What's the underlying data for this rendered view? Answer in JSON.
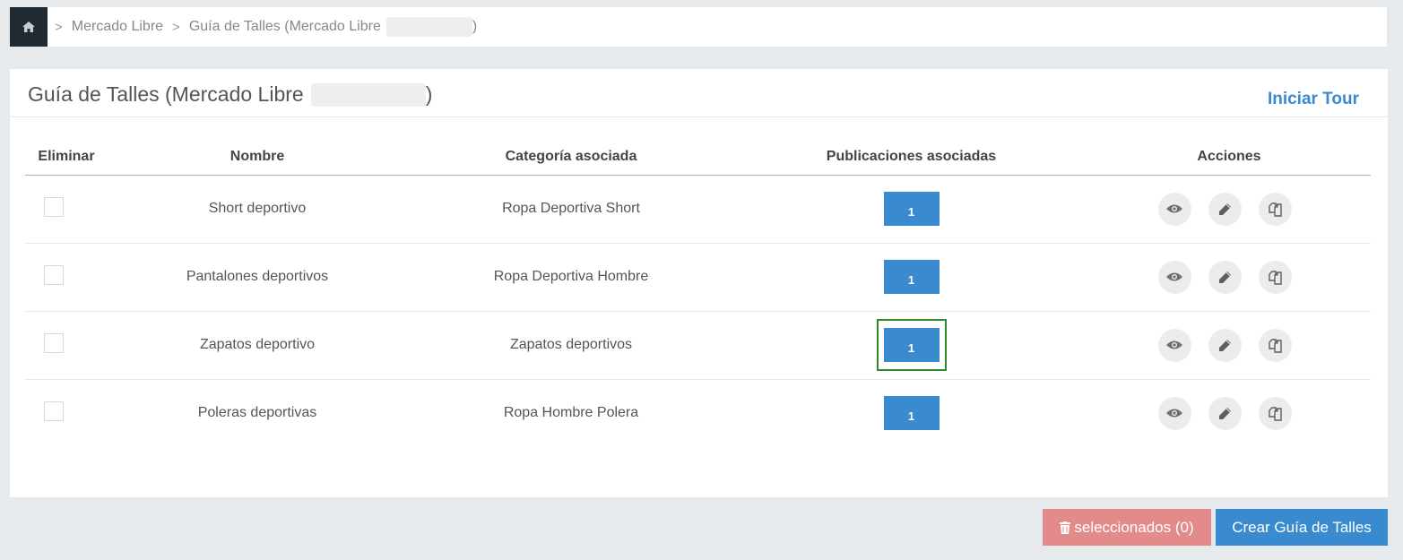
{
  "breadcrumb": {
    "items": [
      "Mercado Libre",
      "Guía de Talles (Mercado Libre",
      ")"
    ]
  },
  "panel": {
    "title_prefix": "Guía de Talles (Mercado Libre",
    "title_suffix": ")",
    "tour_label": "Iniciar Tour"
  },
  "table": {
    "headers": [
      "Eliminar",
      "Nombre",
      "Categoría asociada",
      "Publicaciones asociadas",
      "Acciones"
    ],
    "rows": [
      {
        "name": "Short deportivo",
        "category": "Ropa Deportiva Short",
        "publications": "1"
      },
      {
        "name": "Pantalones deportivos",
        "category": "Ropa Deportiva Hombre",
        "publications": "1"
      },
      {
        "name": "Zapatos deportivo",
        "category": "Zapatos deportivos",
        "publications": "1"
      },
      {
        "name": "Poleras deportivas",
        "category": "Ropa Hombre Polera",
        "publications": "1"
      }
    ]
  },
  "actions": {
    "delete_selected_label": "seleccionados (0)",
    "create_label": "Crear Guía de Talles"
  },
  "icons": {
    "home": "home-icon",
    "view": "eye-icon",
    "edit": "pencil-icon",
    "copy": "copy-icon",
    "delete": "trash-icon"
  },
  "colors": {
    "primary": "#3a8ad0",
    "danger": "#e38b8a",
    "home_bg": "#1f2a33",
    "highlight": "#2e8b2e"
  }
}
